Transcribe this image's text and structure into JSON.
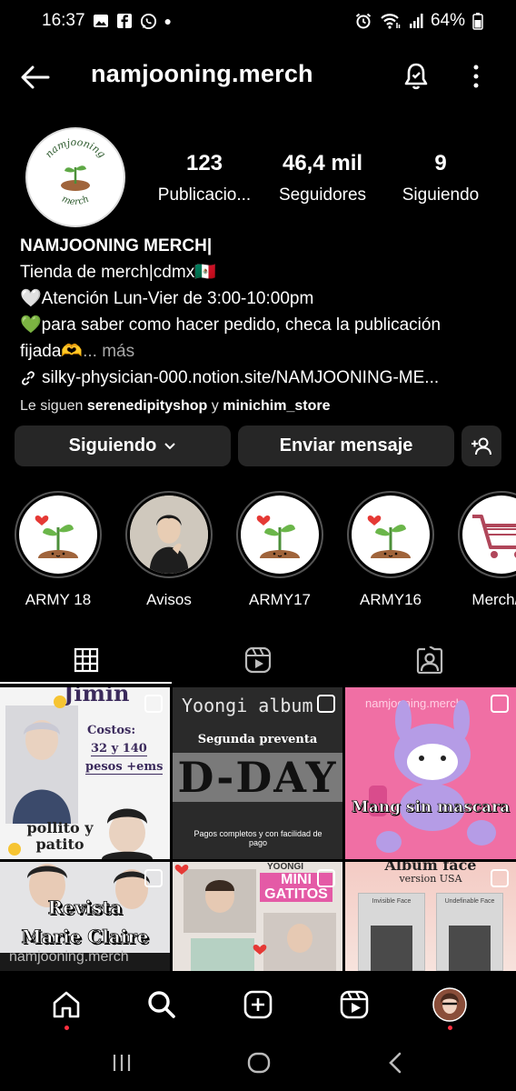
{
  "status_bar": {
    "time": "16:37",
    "battery": "64%"
  },
  "header": {
    "username": "namjooning.merch"
  },
  "avatar": {
    "text_top": "namjooning",
    "text_bottom": "merch"
  },
  "stats": [
    {
      "value": "123",
      "label": "Publicacio..."
    },
    {
      "value": "46,4 mil",
      "label": "Seguidores"
    },
    {
      "value": "9",
      "label": "Siguiendo"
    }
  ],
  "bio": {
    "name": "NAMJOONING MERCH|",
    "line1": "Tienda de merch|cdmx🇲🇽",
    "line2": "🤍Atención Lun-Vier de 3:00-10:00pm",
    "line3": "💚para saber como hacer pedido, checa la publicación",
    "line4": "fijada🫶",
    "more": "... más",
    "link": "silky-physician-000.notion.site/NAMJOONING-ME...",
    "followed_prefix": "Le siguen",
    "followed_user1": "serenedipityshop",
    "followed_and": "y",
    "followed_user2": "minichim_store"
  },
  "buttons": {
    "following": "Siguiendo",
    "message": "Enviar mensaje"
  },
  "highlights": [
    {
      "label": "ARMY 18"
    },
    {
      "label": "Avisos"
    },
    {
      "label": "ARMY17"
    },
    {
      "label": "ARMY16"
    },
    {
      "label": "Merch/O"
    }
  ],
  "posts": [
    {
      "title": "Jimin",
      "t2": "Costos:",
      "t3": "32 y 140",
      "t4": "pesos +ems",
      "t5": "pollito y patito"
    },
    {
      "title": "Yoongi album",
      "t2": "Segunda preventa",
      "t3": "D-DAY",
      "t4": "Pagos completos y con facilidad de pago"
    },
    {
      "title": "namjooning.merch",
      "t2": "Mang sin mascara"
    },
    {
      "title": "Revista",
      "t2": "Marie Claire",
      "t3": "namjooning.merch"
    },
    {
      "title": "YOONGI",
      "t2": "MINI",
      "t3": "GATITOS"
    },
    {
      "title": "Album face",
      "t2": "version USA",
      "t3": "Invisible Face",
      "t4": "Undefinable Face"
    }
  ],
  "colors": {
    "background": "#000000",
    "button": "#262626",
    "accent_red": "#ff3040",
    "muted": "#a8a8a8"
  }
}
